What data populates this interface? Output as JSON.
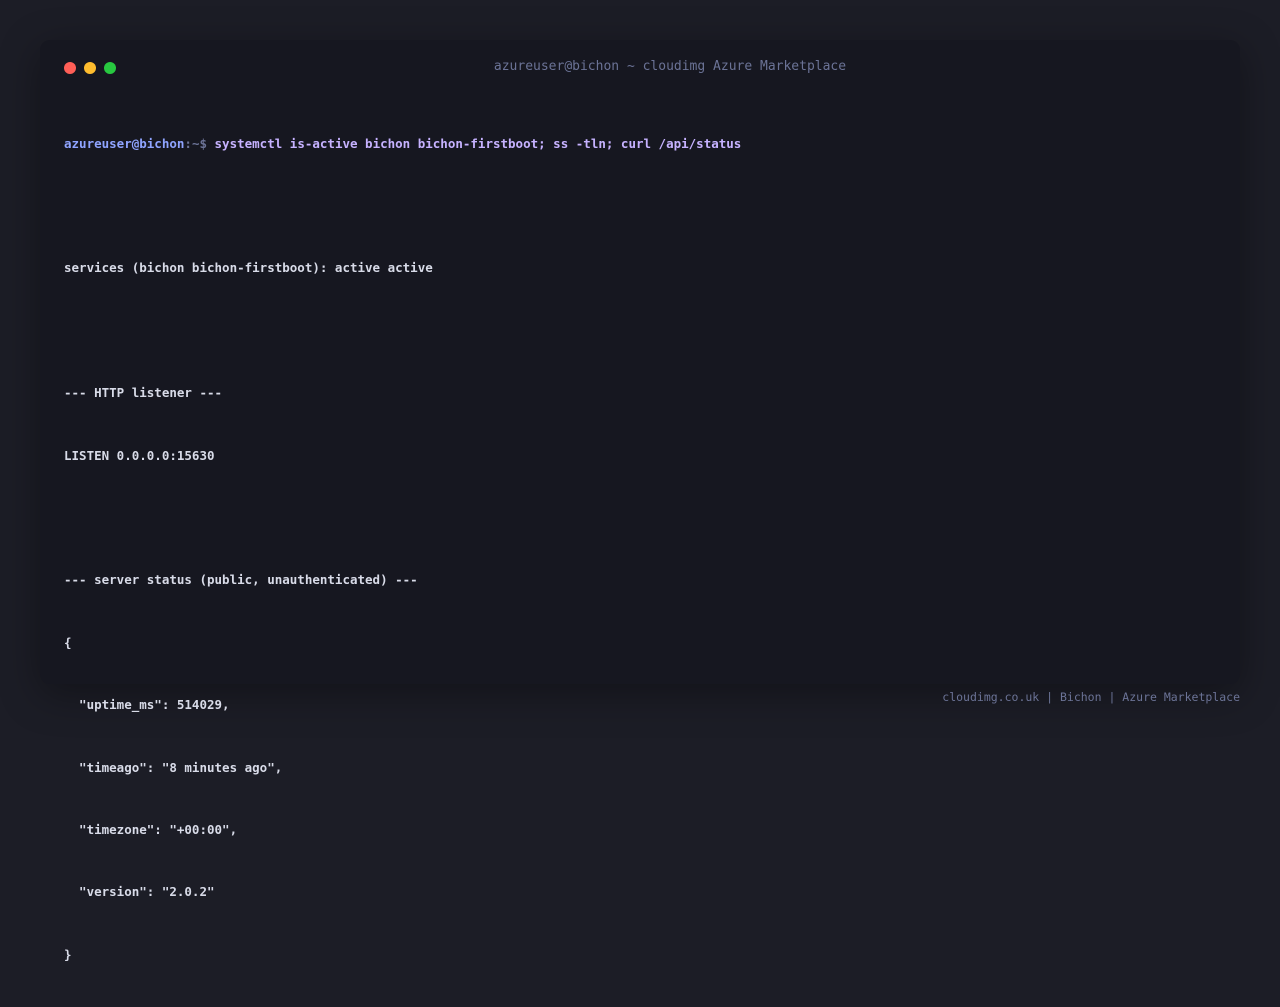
{
  "window": {
    "title": "azureuser@bichon ~ cloudimg Azure Marketplace"
  },
  "prompt": {
    "user_host": "azureuser@bichon",
    "path_symbol": ":~$ ",
    "command": "systemctl is-active bichon bichon-firstboot; ss -tln; curl /api/status"
  },
  "output": {
    "services_line": "services (bichon bichon-firstboot): active active",
    "http_header": "--- HTTP listener ---",
    "listen_line": "LISTEN 0.0.0.0:15630",
    "status_header": "--- server status (public, unauthenticated) ---",
    "json_open": "{",
    "json_lines": [
      "  \"uptime_ms\": 514029,",
      "  \"timeago\": \"8 minutes ago\",",
      "  \"timezone\": \"+00:00\",",
      "  \"version\": \"2.0.2\""
    ],
    "json_close": "}"
  },
  "footer": {
    "text": "cloudimg.co.uk | Bichon | Azure Marketplace"
  },
  "colors": {
    "background": "#1c1d26",
    "terminal_bg": "#161720",
    "prompt_user": "#8fa4ff",
    "command": "#c6b2ff",
    "text": "#d8dbe8",
    "muted": "#6b7396",
    "light_red": "#ff5f57",
    "light_yellow": "#febc2e",
    "light_green": "#28c840"
  }
}
